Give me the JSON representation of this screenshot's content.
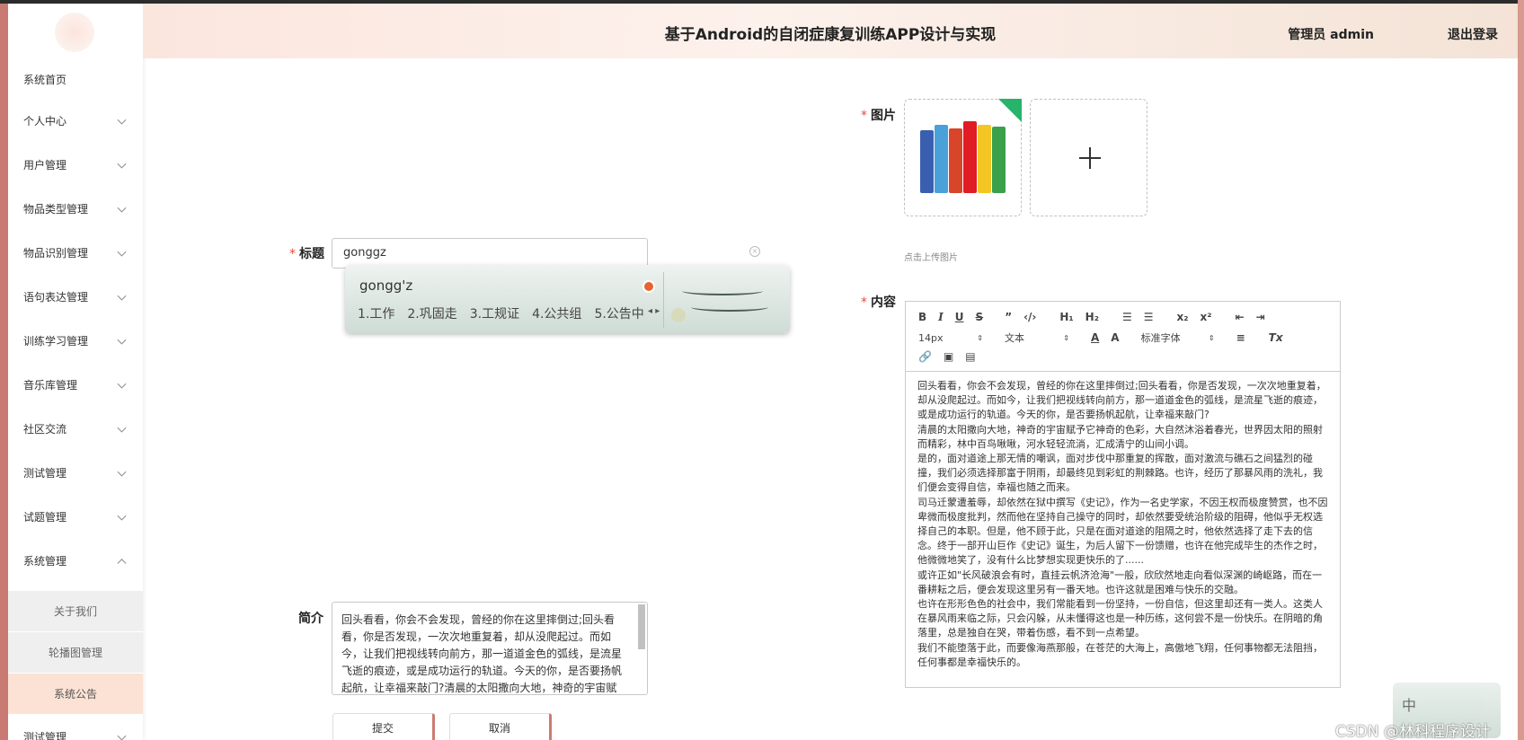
{
  "header": {
    "title": "基于Android的自闭症康复训练APP设计与实现",
    "user": "管理员 admin",
    "logout": "退出登录"
  },
  "sidebar": {
    "items": [
      {
        "label": "系统首页"
      },
      {
        "label": "个人中心"
      },
      {
        "label": "用户管理"
      },
      {
        "label": "物品类型管理"
      },
      {
        "label": "物品识别管理"
      },
      {
        "label": "语句表达管理"
      },
      {
        "label": "训练学习管理"
      },
      {
        "label": "音乐库管理"
      },
      {
        "label": "社区交流"
      },
      {
        "label": "测试管理"
      },
      {
        "label": "试题管理"
      },
      {
        "label": "系统管理"
      }
    ],
    "sub_items": [
      {
        "label": "关于我们"
      },
      {
        "label": "轮播图管理"
      },
      {
        "label": "系统公告"
      }
    ],
    "bottom_item": {
      "label": "测试管理"
    }
  },
  "form": {
    "title_label": "标题",
    "title_value": "gonggz",
    "ime": {
      "composition": "gongg'z",
      "candidates": [
        "1.工作",
        "2.巩固走",
        "3.工规证",
        "4.公共组",
        "5.公告中"
      ]
    },
    "summary_label": "简介",
    "summary_text": "回头看看，你会不会发现，曾经的你在这里摔倒过;回头看看，你是否发现，一次次地重复着，却从没爬起过。而如今，让我们把视线转向前方，那一道道金色的弧线，是流星飞逝的痕迹，或是成功运行的轨道。今天的你，是否要扬帆起航，让幸福来敲门?清晨的太阳撒向大地，神奇的宇宙赋予",
    "submit": "提交",
    "cancel": "取消",
    "image_label": "图片",
    "upload_hint": "点击上传图片",
    "content_label": "内容",
    "content_paragraphs": [
      "回头看看，你会不会发现，曾经的你在这里摔倒过;回头看看，你是否发现，一次次地重复着，却从没爬起过。而如今，让我们把视线转向前方，那一道道金色的弧线，是流星飞逝的痕迹，或是成功运行的轨道。今天的你，是否要扬帆起航，让幸福来敲门?",
      "清晨的太阳撒向大地，神奇的宇宙赋予它神奇的色彩，大自然沐浴着春光，世界因太阳的照射而精彩，林中百鸟啾啾，河水轻轻流淌，汇成清宁的山间小调。",
      "是的，面对道途上那无情的嘲讽，面对步伐中那重复的挥散，面对激流与礁石之间猛烈的碰撞，我们必须选择那富于阴雨，却最终见到彩虹的荆棘路。也许，经历了那暴风雨的洗礼，我们便会变得自信，幸福也随之而来。",
      "司马迁蒙遭羞辱，却依然在狱中撰写《史记》，作为一名史学家，不因王权而极度赞赏，也不因卑微而极度批判，然而他在坚持自己操守的同时，却依然要受统治阶级的阻碍，他似乎无权选择自己的本职。但是，他不顾于此，只是在面对道途的阻隔之时，他依然选择了走下去的信念。终于一部开山巨作《史记》诞生，为后人留下一份馈赠，也许在他完成毕生的杰作之时，他微微地笑了，没有什么比梦想实现更快乐的了......",
      "或许正如\"长风破浪会有时，直挂云帆济沧海\"一般，欣欣然地走向看似深渊的崎岖路，而在一番耕耘之后，便会发现这里另有一番天地。也许这就是困难与快乐的交融。",
      "也许在形形色色的社会中，我们常能看到一份坚持，一份自信，但这里却还有一类人。这类人在暴风雨来临之际，只会闪躲，从未懂得这也是一种历练，这何尝不是一份快乐。在阴暗的角落里，总是独自在哭，带着伤感，看不到一点希望。",
      "我们不能堕落于此，而要像海燕那般，在苍茫的大海上，高傲地飞翔，任何事物都无法阻挡，任何事都是幸福快乐的。"
    ]
  },
  "editor_toolbar": {
    "font_size": "14px",
    "text_type": "文本",
    "font_family": "标准字体"
  },
  "watermark": {
    "text": "CSDN @林科程序设计",
    "ime_icon": "中"
  },
  "colors": {
    "accent": "#c97b73",
    "required": "#e74c3c",
    "header_bg": "#fbe6de"
  }
}
